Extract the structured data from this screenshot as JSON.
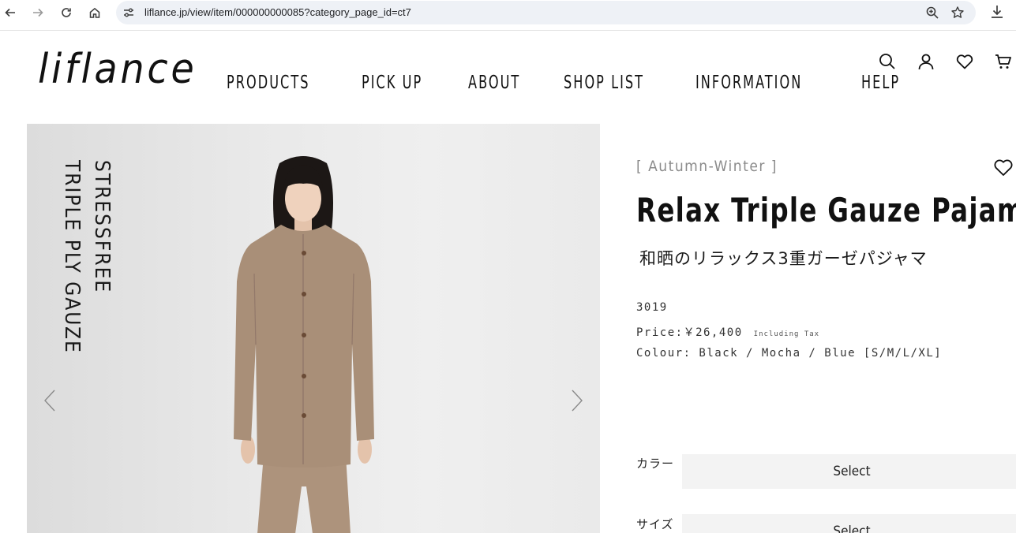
{
  "browser": {
    "url": "liflance.jp/view/item/000000000085?category_page_id=ct7"
  },
  "site": {
    "logo": "liflance",
    "nav": [
      "PRODUCTS",
      "PICK UP",
      "ABOUT",
      "SHOP LIST",
      "INFORMATION",
      "HELP"
    ]
  },
  "gallery": {
    "vertical_text_1": "STRESSFREE",
    "vertical_text_2": "TRIPLE PLY GAUZE"
  },
  "product": {
    "season": "[ Autumn-Winter ]",
    "title": "Relax Triple Gauze Pajamas",
    "title_jp": "和晒のリラックス3重ガーゼパジャマ",
    "code": "3019",
    "price": "Price:￥26,400",
    "tax_note": "Including Tax",
    "colour": "Colour: Black / Mocha / Blue [S/M/L/XL]"
  },
  "options": {
    "color_label": "カラー",
    "color_value": "Select",
    "size_label": "サイズ",
    "size_value": "Select"
  },
  "colors": {
    "accent": "#111111",
    "muted": "#8b8b8b",
    "select_bg": "#f3f3f3",
    "garment": "#a98f78"
  }
}
